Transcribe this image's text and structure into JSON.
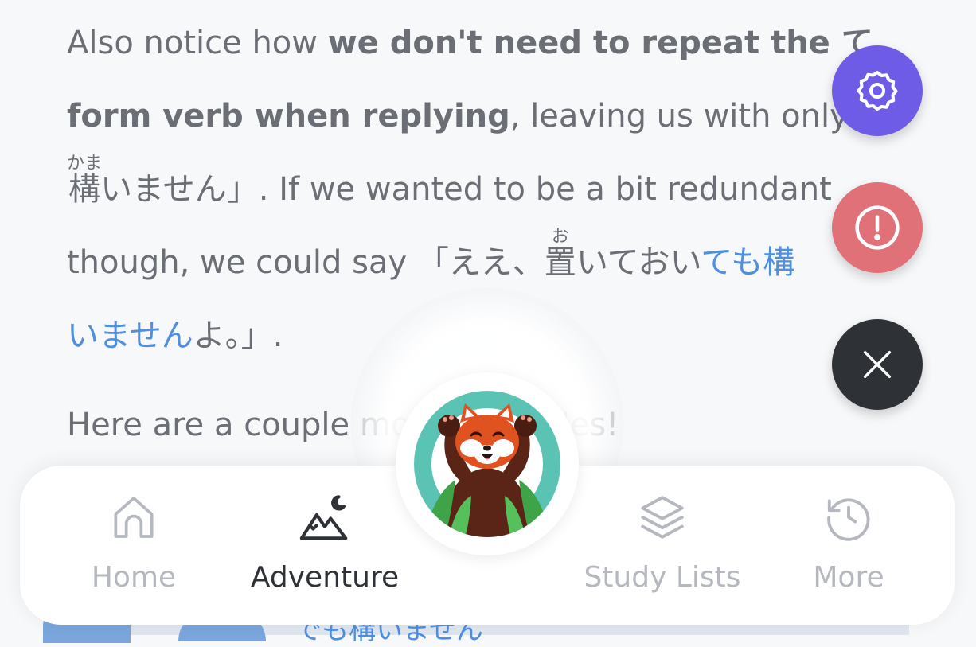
{
  "lesson": {
    "para1": {
      "t1": "Also notice how ",
      "b1": "we don't need to repeat the ",
      "b1_jp": "て",
      "b2": "form verb when replying",
      "t2": ", leaving us with only 「",
      "kanji_kamau": "構",
      "furigana_kamau": "かま",
      "t3": "いません」. If we wanted to be a bit redundant",
      "t4": "though, we could say 「ええ、",
      "kanji_oku": "置",
      "furigana_oku": "お",
      "t5": "いておい",
      "blue1": "ても構",
      "blue2": "いません",
      "t6": "よ。」."
    },
    "para2": "Here are a couple more examples!"
  },
  "fabs": {
    "settings_icon": "gear-icon",
    "report_icon": "alert-circle-icon",
    "close_icon": "close-icon"
  },
  "bottom_partial_text": "でも構いません",
  "tabbar": {
    "tabs": [
      {
        "label": "Home",
        "icon": "home-icon",
        "active": false
      },
      {
        "label": "Adventure",
        "icon": "mountain-moon-icon",
        "active": true
      },
      {
        "label": "Study Lists",
        "icon": "layers-icon",
        "active": false
      },
      {
        "label": "More",
        "icon": "history-icon",
        "active": false
      }
    ],
    "center": {
      "icon": "red-panda-mascot"
    }
  },
  "colors": {
    "accent_purple": "#6e5ce6",
    "report_red": "#e07179",
    "close_dark": "#2e3237",
    "link_blue": "#4f8fe0",
    "text_gray": "#6b6f75"
  }
}
